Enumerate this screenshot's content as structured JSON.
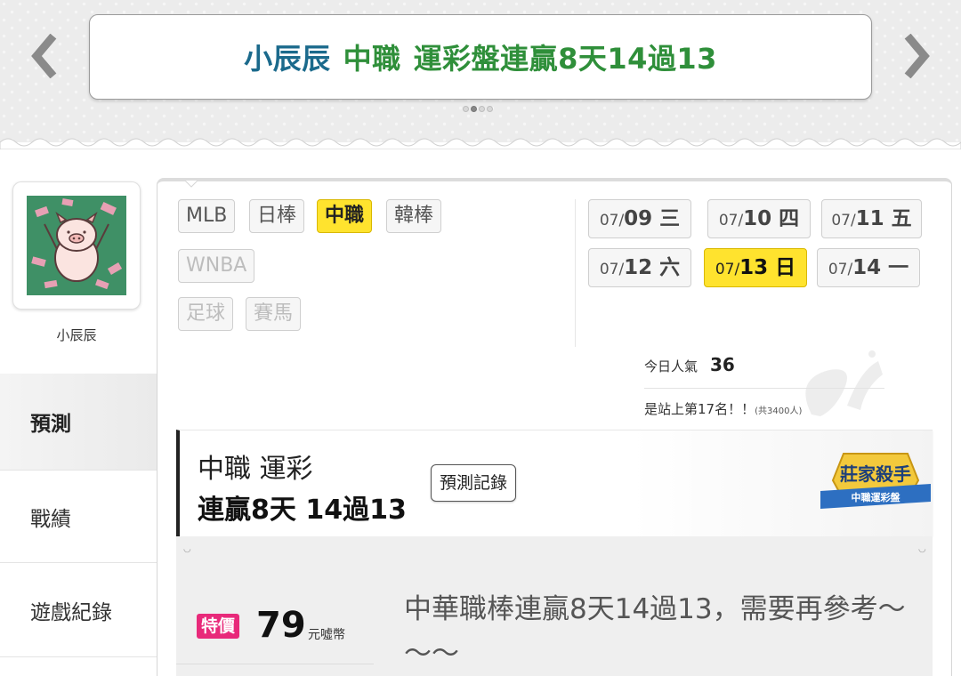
{
  "banner": {
    "name": "小辰辰",
    "league": "中職",
    "text": "運彩盤連贏8天14過13"
  },
  "user": {
    "name": "小辰辰"
  },
  "sidebar": {
    "tabs": [
      "預測",
      "戰績",
      "遊戲紀錄"
    ]
  },
  "leagues": {
    "row1": [
      "MLB",
      "日棒",
      "中職",
      "韓棒"
    ],
    "row2": [
      "WNBA"
    ],
    "row3": [
      "足球",
      "賽馬"
    ]
  },
  "dates": [
    {
      "md": "07/",
      "day": "09 三"
    },
    {
      "md": "07/",
      "day": "10 四"
    },
    {
      "md": "07/",
      "day": "11 五"
    },
    {
      "md": "07/",
      "day": "12 六"
    },
    {
      "md": "07/",
      "day": "13 日"
    },
    {
      "md": "07/",
      "day": "14 一"
    }
  ],
  "stats": {
    "popularity_label": "今日人氣",
    "popularity_value": "36",
    "rank_text": "是站上第17名！！",
    "rank_total": "(共3400人)"
  },
  "headline": {
    "line1": "中職 運彩",
    "line2": "連贏8天 14過13",
    "history_button": "預測記錄"
  },
  "badge": {
    "title": "莊家殺手",
    "subtitle": "中職運彩盤"
  },
  "offer": {
    "tag": "特價",
    "price": "79",
    "unit": "元噓幣",
    "description": "中華職棒連贏8天14過13，需要再參考～～～"
  },
  "colors": {
    "active_yellow": "#ffe32e",
    "banner_blue": "#1b6a8c",
    "banner_green": "#2f8f3a",
    "price_pink": "#e8297a"
  }
}
